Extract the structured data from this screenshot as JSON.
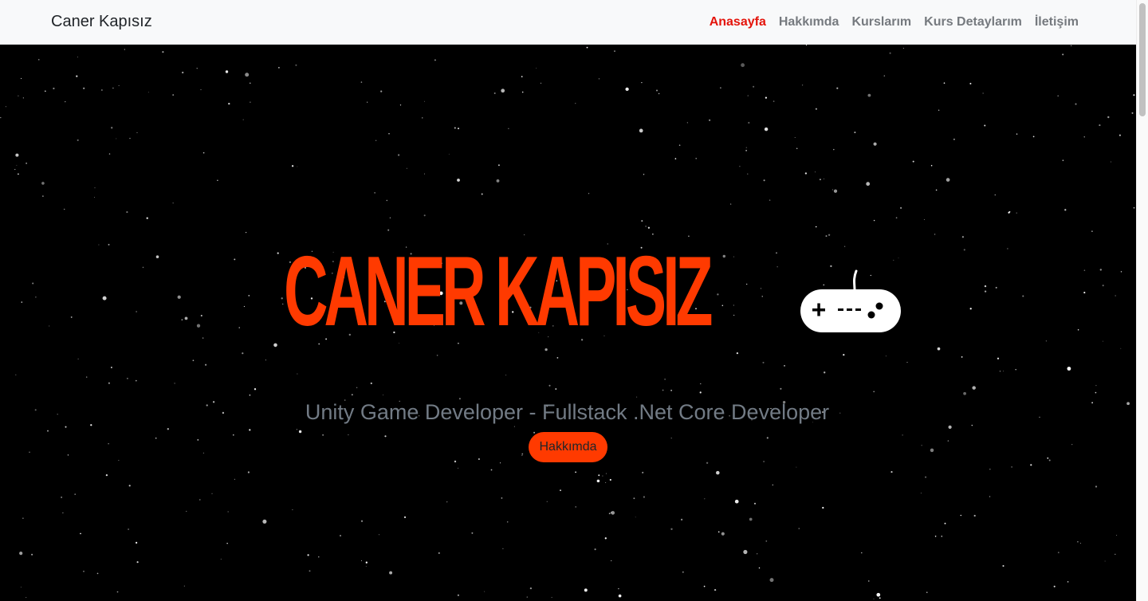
{
  "navbar": {
    "brand": "Caner Kapısız",
    "links": [
      {
        "label": "Anasayfa",
        "active": true
      },
      {
        "label": "Hakkımda",
        "active": false
      },
      {
        "label": "Kurslarım",
        "active": false
      },
      {
        "label": "Kurs Detaylarım",
        "active": false
      },
      {
        "label": "İletişim",
        "active": false
      }
    ]
  },
  "hero": {
    "title": "CANER KAPISIZ",
    "subtitle": "Unity Game Developer - Fullstack .Net Core Developer",
    "button_label": "Hakkımda",
    "icon": "gamepad-icon"
  },
  "colors": {
    "accent": "#ff3a00",
    "active_link": "#e4140b",
    "nav_link": "#767a7f",
    "subtitle": "#727b85",
    "navbar_bg": "#f8f9fa",
    "hero_bg": "#000000"
  }
}
